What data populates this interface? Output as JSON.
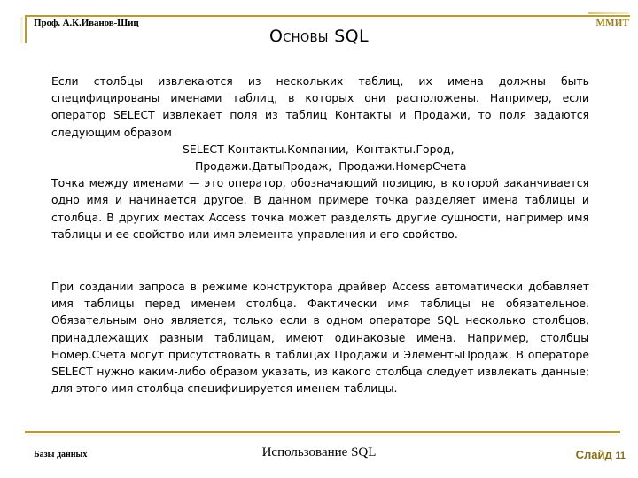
{
  "slide": {
    "author": "Проф. А.К.Иванов-Шиц",
    "organization": "ММИТ",
    "title": "Основы SQL",
    "accent_color": "#b49b34",
    "org_color": "#9a7f1f",
    "slide_number_color": "#8a6d12",
    "background_color": "#ffffff",
    "text_color": "#000000"
  },
  "body": {
    "paragraph_1": "Если столбцы извлекаются из нескольких таблиц, их имена должны быть специфицированы  именами таблиц, в которых они расположены. Например, если оператор SELECT  извлекает  поля из таблиц Контакты и Продажи, то поля задаются следующим образом",
    "code_line_1": "SELECT Контакты.Компании,  Контакты.Город,",
    "code_line_2": "Продажи.ДатыПродаж,  Продажи.НомерСчета",
    "paragraph_2": "Точка между именами — это оператор, обозначающий позицию, в которой заканчивается одно имя и начинается другое. В данном примере точка разделяет имена таблицы и столбца. В других местах Access точка может разделять другие сущности, например имя таблицы и ее свойство или имя элемента управления и его свойство.",
    "paragraph_3": "При создании запроса в режиме конструктора драйвер Access автоматически добавляет имя таблицы перед именем столбца. Фактически имя таблицы не обязательное. Обязательным оно является, только если в одном операторе SQL несколько столбцов, принадлежащих разным таблицам, имеют одинаковые имена. Например, столбцы Номер.Счета могут присутствовать в таблицах Продажи и ЭлементыПродаж. В операторе SELECT нужно каким-либо образом указать, из какого столбца следует извлекать данные; для этого имя столбца специфицируется именем  таблицы."
  },
  "footer": {
    "left": "Базы данных",
    "center": "Использование SQL",
    "right_label": "Слайд",
    "slide_number": "11"
  }
}
